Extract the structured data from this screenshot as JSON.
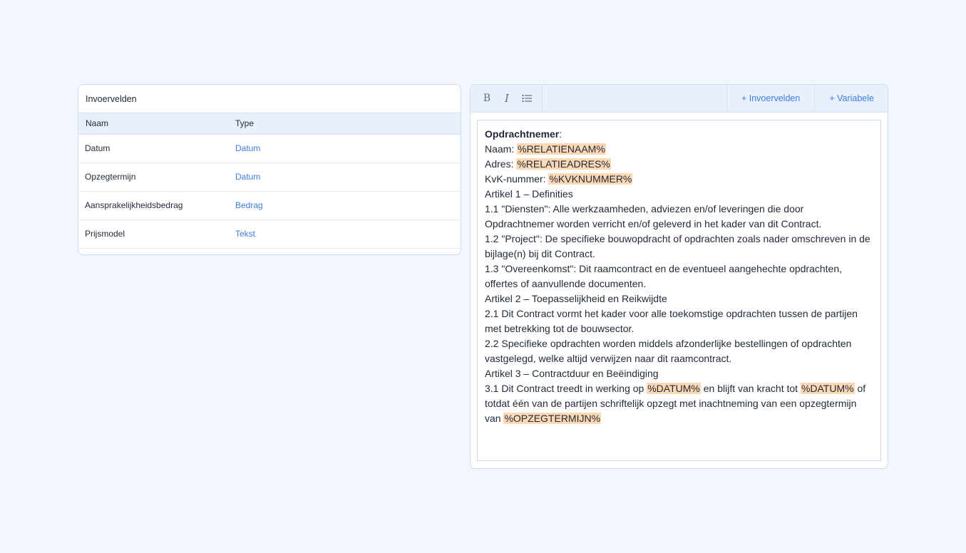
{
  "fields_panel": {
    "title": "Invoervelden",
    "columns": {
      "name": "Naam",
      "type": "Type"
    },
    "rows": [
      {
        "name": "Datum",
        "type": "Datum"
      },
      {
        "name": "Opzegtermijn",
        "type": "Datum"
      },
      {
        "name": "Aansprakelijkheidsbedrag",
        "type": "Bedrag"
      },
      {
        "name": "Prijsmodel",
        "type": "Tekst"
      }
    ]
  },
  "toolbar": {
    "bold_glyph": "B",
    "italic_glyph": "I",
    "insert_fields_label": "+ Invoervelden",
    "insert_variable_label": "+ Variabele"
  },
  "document": {
    "heading": "Opdrachtnemer",
    "heading_suffix": ":",
    "naam_label": "Naam: ",
    "naam_var": "%RELATIENAAM%",
    "adres_label": "Adres: ",
    "adres_var": "%RELATIEADRES%",
    "kvk_label": "KvK-nummer: ",
    "kvk_var": "%KVKNUMMER%",
    "art1_title": "Artikel 1 – Definities",
    "art1_1": "1.1 \"Diensten\": Alle werkzaamheden, adviezen en/of leveringen die door Opdrachtnemer worden verricht en/of geleverd in het kader van dit Contract.",
    "art1_2": "1.2 \"Project\": De specifieke bouwopdracht of opdrachten zoals nader omschreven in de bijlage(n) bij dit Contract.",
    "art1_3": "1.3 \"Overeenkomst\": Dit raamcontract en de eventueel aangehechte opdrachten, offertes of aanvullende documenten.",
    "art2_title": "Artikel 2 – Toepasselijkheid en Reikwijdte",
    "art2_1": "2.1 Dit Contract vormt het kader voor alle toekomstige opdrachten tussen de partijen met betrekking tot de bouwsector.",
    "art2_2": "2.2 Specifieke opdrachten worden middels afzonderlijke bestellingen of opdrachten vastgelegd, welke altijd verwijzen naar dit raamcontract.",
    "art3_title": "Artikel 3 – Contractduur en Beëindiging",
    "art3_1_a": "3.1 Dit Contract treedt in werking op ",
    "art3_1_var1": "%DATUM%",
    "art3_1_b": " en blijft van kracht tot ",
    "art3_1_var2": "%DATUM%",
    "art3_1_c": " of totdat één van de partijen schriftelijk opzegt met inachtneming van een opzegtermijn van ",
    "art3_1_var3": "%OPZEGTERMIJN%"
  },
  "colors": {
    "background": "#f2f6fd",
    "accent": "#3b7de0",
    "variable_highlight": "#fdd8b5",
    "header_bg": "#e9f0fd"
  },
  "icons": {
    "bold": "bold-icon",
    "italic": "italic-icon",
    "list": "list-icon"
  }
}
